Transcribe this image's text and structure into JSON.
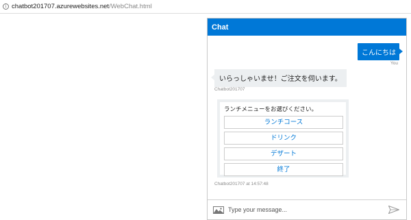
{
  "browser": {
    "url_domain": "chatbot201707.azurewebsites.net",
    "url_path": "/WebChat.html"
  },
  "chat": {
    "header_title": "Chat",
    "user_message": "こんにちは",
    "user_label": "You",
    "bot_message": "いらっしゃいませ！ご注文を伺います。",
    "bot_label": "Chatbot201707",
    "card": {
      "title": "ランチメニューをお選びください。",
      "buttons": [
        "ランチコース",
        "ドリンク",
        "デザート",
        "終了"
      ]
    },
    "card_label": "Chatbot201707 at 14:57:48",
    "input_placeholder": "Type your message..."
  },
  "colors": {
    "accent": "#0078d7",
    "bot_bubble": "#eceff1"
  },
  "icons": {
    "image": "image-upload-icon",
    "send": "send-icon",
    "info": "info-icon"
  }
}
